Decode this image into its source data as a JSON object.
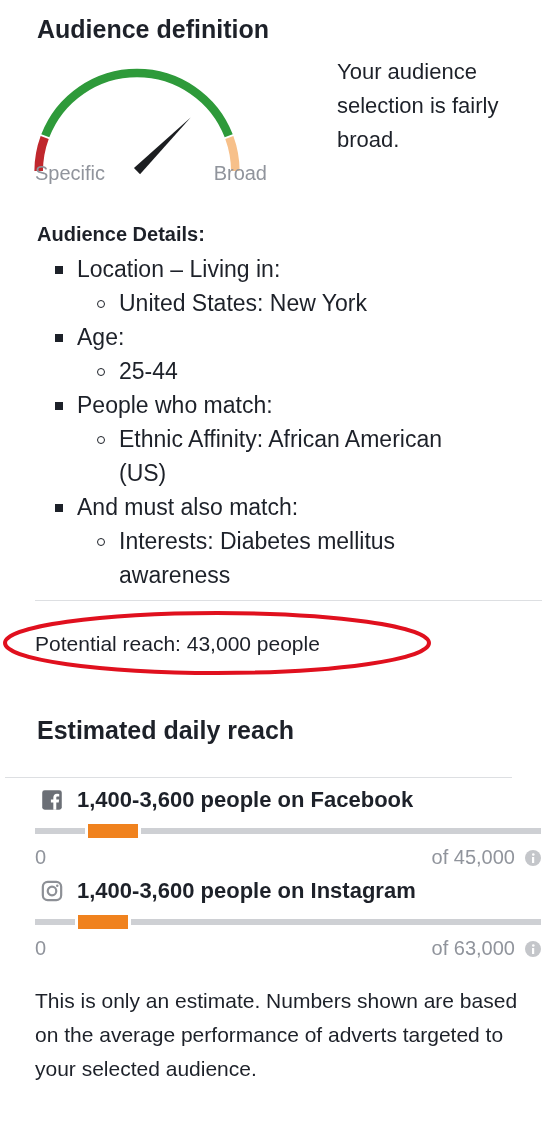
{
  "audience_definition": {
    "title": "Audience definition",
    "gauge": {
      "low_label": "Specific",
      "high_label": "Broad"
    },
    "summary": "Your audience selection is fairly broad."
  },
  "audience_details": {
    "title": "Audience Details:",
    "items": [
      {
        "text": "Location – Living in:",
        "children": [
          {
            "text": "United States: New York"
          }
        ]
      },
      {
        "text": "Age:",
        "children": [
          {
            "text": "25-44"
          }
        ]
      },
      {
        "text": "People who match:",
        "children": [
          {
            "text": "Ethnic Affinity: African American (US)"
          }
        ]
      },
      {
        "text": "And must also match:",
        "children": [
          {
            "text": "Interests: Diabetes mellitus awareness"
          }
        ]
      }
    ]
  },
  "potential_reach": {
    "text": "Potential reach: 43,000 people",
    "highlighted": true
  },
  "estimated_daily_reach": {
    "title": "Estimated daily reach",
    "platforms": [
      {
        "kind": "facebook",
        "label": "1,400-3,600 people on Facebook",
        "level": 0.17,
        "min": "0",
        "max": "of 45,000"
      },
      {
        "kind": "instagram",
        "label": "1,400-3,600 people on Instagram",
        "level": 0.15,
        "min": "0",
        "max": "of 63,000"
      }
    ],
    "note": "This is only an estimate. Numbers shown are based on the average performance of adverts targeted to your selected audience."
  }
}
